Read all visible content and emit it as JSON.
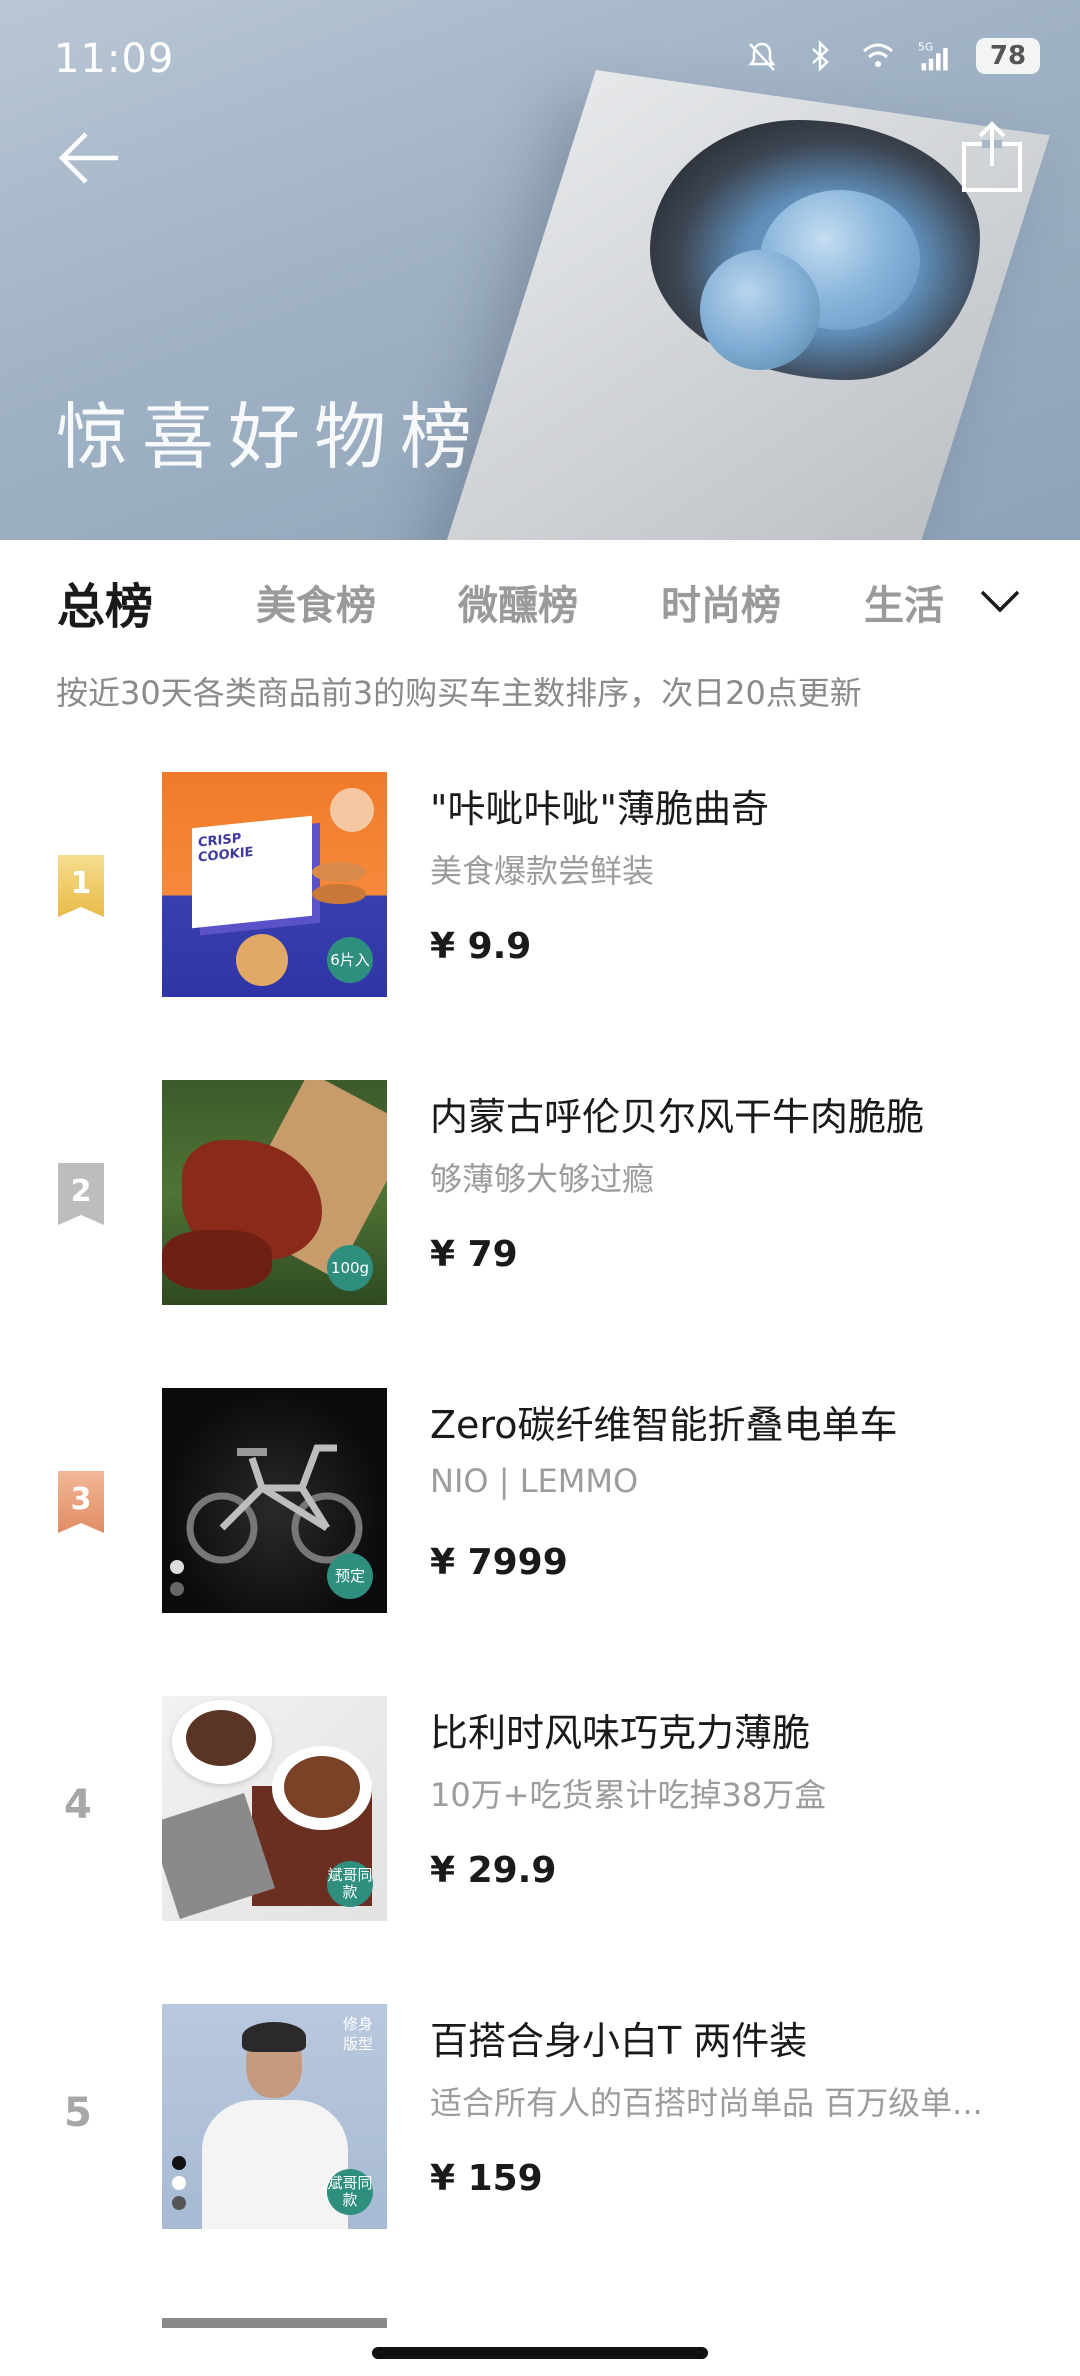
{
  "status_bar": {
    "time": "11:09",
    "network": "5G",
    "battery": "78"
  },
  "hero": {
    "title": "惊喜好物榜"
  },
  "tabs": [
    {
      "label": "总榜",
      "active": true
    },
    {
      "label": "美食榜",
      "active": false
    },
    {
      "label": "微醺榜",
      "active": false
    },
    {
      "label": "时尚榜",
      "active": false
    },
    {
      "label": "生活",
      "active": false
    }
  ],
  "subtitle": "按近30天各类商品前3的购买车主数排序，次日20点更新",
  "items": [
    {
      "rank": "1",
      "title": "\"咔呲咔呲\"薄脆曲奇",
      "desc": "美食爆款尝鲜装",
      "price": "¥ 9.9",
      "thumb_text": "CRISP\nCOOKIE",
      "tag": "6片入"
    },
    {
      "rank": "2",
      "title": "内蒙古呼伦贝尔风干牛肉脆脆",
      "desc": "够薄够大够过瘾",
      "price": "¥ 79",
      "tag": "100g"
    },
    {
      "rank": "3",
      "title": "Zero碳纤维智能折叠电单车",
      "desc": "NIO | LEMMO",
      "price": "¥ 7999",
      "tag": "预定"
    },
    {
      "rank": "4",
      "title": "比利时风味巧克力薄脆",
      "desc": "10万+吃货累计吃掉38万盒",
      "price": "¥ 29.9",
      "tag": "斌哥同款"
    },
    {
      "rank": "5",
      "title": "百搭合身小白T 两件装",
      "desc": "适合所有人的百搭时尚单品 百万级单...",
      "price": "¥ 159",
      "tag": "斌哥同款",
      "thumb_text": "修身版型"
    }
  ],
  "colors": {
    "gold": "#efc964",
    "silver": "#bdbdbd",
    "bronze": "#e6a07e",
    "tag_green": "#2f8f7f"
  }
}
